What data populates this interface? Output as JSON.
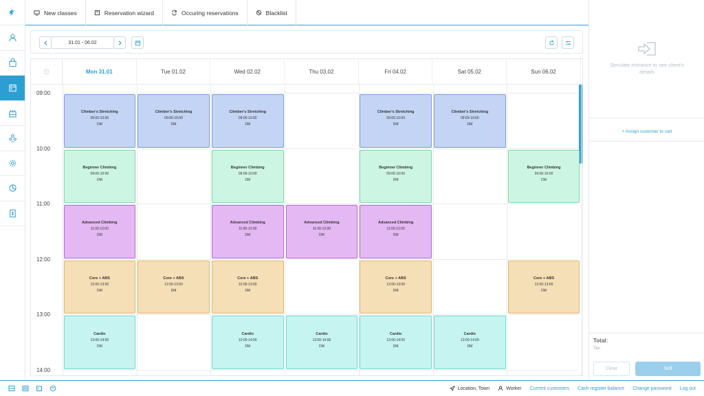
{
  "topnav": {
    "tabs": [
      {
        "label": "New classes",
        "icon": "monitor-icon"
      },
      {
        "label": "Reservation wizard",
        "icon": "book-icon"
      },
      {
        "label": "Occuring reservations",
        "icon": "repeat-icon"
      },
      {
        "label": "Blacklist",
        "icon": "ban-icon"
      }
    ]
  },
  "sidebar": {
    "items": [
      {
        "icon": "user-icon",
        "active": false
      },
      {
        "icon": "bag-icon",
        "active": false
      },
      {
        "icon": "calendar-icon",
        "active": true
      },
      {
        "icon": "building-icon",
        "active": false
      },
      {
        "icon": "people-icon",
        "active": false
      },
      {
        "icon": "gear-icon",
        "active": false
      },
      {
        "icon": "pie-chart-icon",
        "active": false
      },
      {
        "icon": "receipt-icon",
        "active": false
      }
    ]
  },
  "toolbar": {
    "date_range": "31.01 - 06.02"
  },
  "calendar": {
    "days": [
      {
        "label": "Mon 31.01",
        "today": true
      },
      {
        "label": "Tue 01.02",
        "today": false
      },
      {
        "label": "Wed 02.02",
        "today": false
      },
      {
        "label": "Thu 03.02",
        "today": false
      },
      {
        "label": "Fri 04.02",
        "today": false
      },
      {
        "label": "Sat 05.02",
        "today": false
      },
      {
        "label": "Sun 06.02",
        "today": false
      }
    ],
    "times": [
      "09:00",
      "10:00",
      "11:00",
      "12:00",
      "13:00",
      "14:00"
    ],
    "events": [
      {
        "day": 0,
        "slot": 0,
        "title": "Climber's Stretching",
        "time": "09:00-10:00",
        "instructor": "DM",
        "kind": "stretch"
      },
      {
        "day": 1,
        "slot": 0,
        "title": "Climber's Stretching",
        "time": "09:00-10:00",
        "instructor": "DM",
        "kind": "stretch"
      },
      {
        "day": 2,
        "slot": 0,
        "title": "Climber's Stretching",
        "time": "09:00-10:00",
        "instructor": "DM",
        "kind": "stretch"
      },
      {
        "day": 4,
        "slot": 0,
        "title": "Climber's Stretching",
        "time": "09:00-10:00",
        "instructor": "DM",
        "kind": "stretch"
      },
      {
        "day": 5,
        "slot": 0,
        "title": "Climber's Stretching",
        "time": "09:00-10:00",
        "instructor": "DM",
        "kind": "stretch"
      },
      {
        "day": 0,
        "slot": 1,
        "title": "Beginner Climbing",
        "time": "09:00-10:00",
        "instructor": "DM",
        "kind": "beginner"
      },
      {
        "day": 2,
        "slot": 1,
        "title": "Beginner Climbing",
        "time": "09:00-10:00",
        "instructor": "DM",
        "kind": "beginner"
      },
      {
        "day": 4,
        "slot": 1,
        "title": "Beginner Climbing",
        "time": "09:00-10:00",
        "instructor": "DM",
        "kind": "beginner"
      },
      {
        "day": 6,
        "slot": 1,
        "title": "Beginner Climbing",
        "time": "09:00-10:00",
        "instructor": "DM",
        "kind": "beginner"
      },
      {
        "day": 0,
        "slot": 2,
        "title": "Advanced Climbing",
        "time": "11:00-12:00",
        "instructor": "DM",
        "kind": "advanced"
      },
      {
        "day": 2,
        "slot": 2,
        "title": "Advanced Climbing",
        "time": "11:00-12:00",
        "instructor": "DM",
        "kind": "advanced"
      },
      {
        "day": 3,
        "slot": 2,
        "title": "Advanced Climbing",
        "time": "11:00-12:00",
        "instructor": "DM",
        "kind": "advanced"
      },
      {
        "day": 4,
        "slot": 2,
        "title": "Advanced Climbing",
        "time": "11:00-12:00",
        "instructor": "DM",
        "kind": "advanced"
      },
      {
        "day": 0,
        "slot": 3,
        "title": "Core + ABS",
        "time": "12:00-13:00",
        "instructor": "DM",
        "kind": "core"
      },
      {
        "day": 1,
        "slot": 3,
        "title": "Core + ABS",
        "time": "12:00-13:00",
        "instructor": "DM",
        "kind": "core"
      },
      {
        "day": 2,
        "slot": 3,
        "title": "Core + ABS",
        "time": "12:00-13:00",
        "instructor": "DM",
        "kind": "core"
      },
      {
        "day": 4,
        "slot": 3,
        "title": "Core + ABS",
        "time": "12:00-13:00",
        "instructor": "DM",
        "kind": "core"
      },
      {
        "day": 6,
        "slot": 3,
        "title": "Core + ABS",
        "time": "12:00-13:00",
        "instructor": "DM",
        "kind": "core"
      },
      {
        "day": 0,
        "slot": 4,
        "title": "Cardio",
        "time": "13:00-14:00",
        "instructor": "DM",
        "kind": "cardio"
      },
      {
        "day": 2,
        "slot": 4,
        "title": "Cardio",
        "time": "13:00-14:00",
        "instructor": "DM",
        "kind": "cardio"
      },
      {
        "day": 3,
        "slot": 4,
        "title": "Cardio",
        "time": "13:00-14:00",
        "instructor": "DM",
        "kind": "cardio"
      },
      {
        "day": 4,
        "slot": 4,
        "title": "Cardio",
        "time": "13:00-14:00",
        "instructor": "DM",
        "kind": "cardio"
      },
      {
        "day": 5,
        "slot": 4,
        "title": "Cardio",
        "time": "13:00-14:00",
        "instructor": "DM",
        "kind": "cardio"
      }
    ],
    "event_colors": {
      "stretch": {
        "bg": "#c4d4f4",
        "border": "#7d9ce0"
      },
      "beginner": {
        "bg": "#cdf5e3",
        "border": "#7fd6ac"
      },
      "advanced": {
        "bg": "#e4b8f3",
        "border": "#b56ad1"
      },
      "core": {
        "bg": "#f5dfb7",
        "border": "#e3b56b"
      },
      "cardio": {
        "bg": "#c6f4f1",
        "border": "#6fd8d1"
      }
    }
  },
  "rightpanel": {
    "entrance_text": "Simulate entrance to see client's details",
    "assign_link": "+ Assign customer to cart",
    "total_label": "Total:",
    "tax_label": "Tax:",
    "clear_label": "Clear",
    "sell_label": "Sell"
  },
  "footer": {
    "location": "Location, Town",
    "worker": "Worker",
    "links": [
      "Current customers",
      "Cash register balance",
      "Change password",
      "Log out"
    ]
  },
  "colors": {
    "accent": "#2c9fd2"
  }
}
